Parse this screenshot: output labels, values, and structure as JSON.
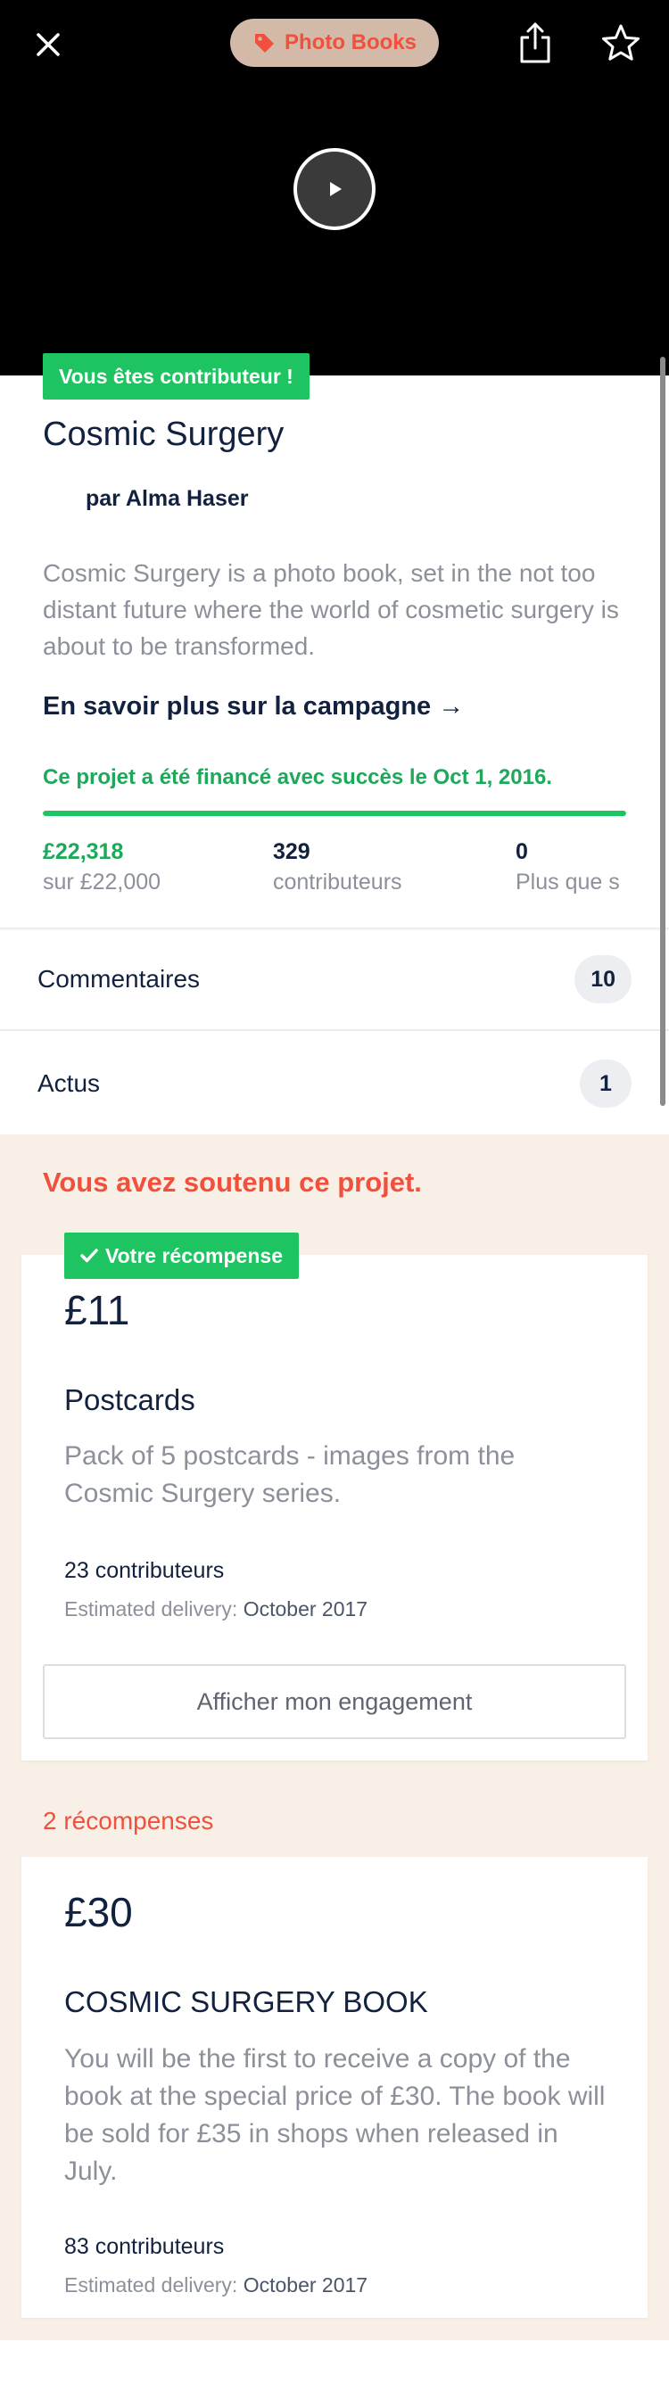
{
  "header": {
    "category_label": "Photo Books",
    "icons": [
      "close-icon",
      "tag-icon",
      "share-icon",
      "star-icon",
      "play-icon"
    ]
  },
  "project": {
    "contributor_badge": "Vous êtes contributeur !",
    "title": "Cosmic Surgery",
    "author": "par Alma Haser",
    "blurb": "Cosmic Surgery is a photo book, set in the not too distant future where the world of cosmetic surgery is about to be transformed.",
    "more_link": "En savoir plus sur la campagne →",
    "funded_message": "Ce projet a été financé avec succès le Oct 1, 2016.",
    "progress_percent": 100,
    "stats": {
      "pledged_value": "£22,318",
      "pledged_label": "sur £22,000",
      "backers_value": "329",
      "backers_label": "contributeurs",
      "third_value": "0",
      "third_label": "Plus que s"
    }
  },
  "links": {
    "comments_label": "Commentaires",
    "comments_count": "10",
    "news_label": "Actus",
    "news_count": "1"
  },
  "rewards": {
    "backed_message": "Vous avez soutenu ce projet.",
    "your_reward_badge": "Votre récompense",
    "backed_reward": {
      "price": "£11",
      "title": "Postcards",
      "description": "Pack of 5 postcards - images from the Cosmic Surgery series.",
      "backers": "23 contributeurs",
      "delivery_label": "Estimated delivery:",
      "delivery_value": "October 2017",
      "button_label": "Afficher mon engagement"
    },
    "count_label": "2 récompenses",
    "other_reward": {
      "price": "£30",
      "title": "COSMIC SURGERY BOOK",
      "description": "You will be the first to receive a copy of the book at the special price of £30. The book will be sold for £35 in shops when released in July.",
      "backers": "83 contributeurs",
      "delivery_label": "Estimated delivery:",
      "delivery_value": "October 2017"
    }
  },
  "colors": {
    "green": "#1ec462",
    "accent_red": "#f0503c",
    "navy": "#12213d",
    "grey_text": "#8c909a",
    "rewards_bg": "#f8efe6"
  }
}
